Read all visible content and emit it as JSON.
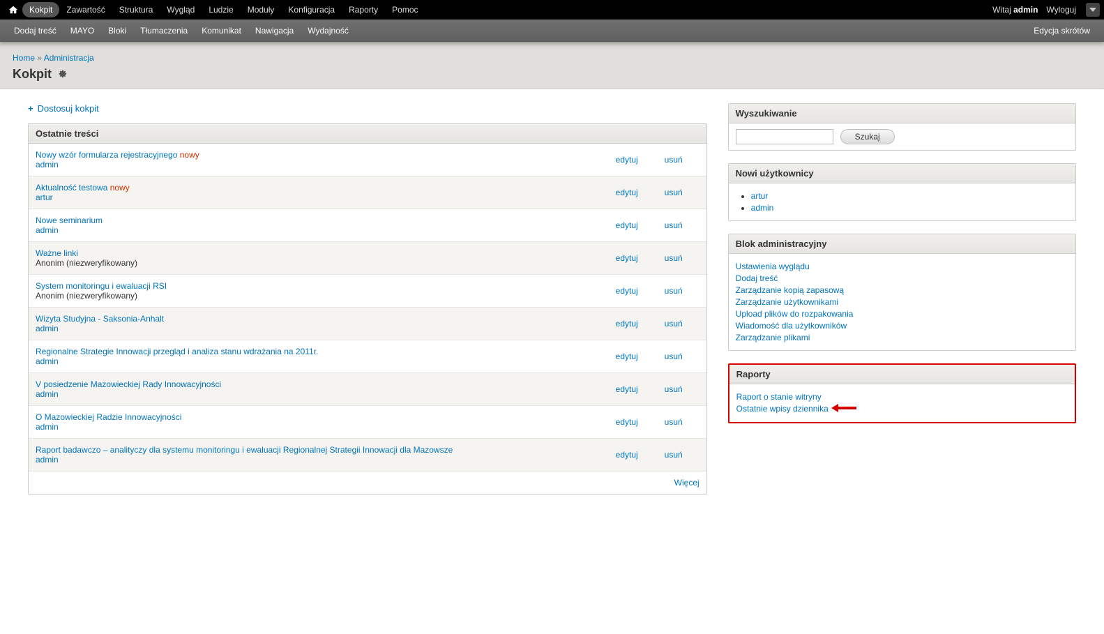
{
  "toolbar": {
    "items": [
      "Kokpit",
      "Zawartość",
      "Struktura",
      "Wygląd",
      "Ludzie",
      "Moduły",
      "Konfiguracja",
      "Raporty",
      "Pomoc"
    ],
    "welcome_prefix": "Witaj ",
    "welcome_user": "admin",
    "logout": "Wyloguj"
  },
  "shortcuts": {
    "items": [
      "Dodaj treść",
      "MAYO",
      "Bloki",
      "Tłumaczenia",
      "Komunikat",
      "Nawigacja",
      "Wydajność"
    ],
    "edit": "Edycja skrótów"
  },
  "breadcrumb": {
    "home": "Home",
    "sep": " » ",
    "admin": "Administracja"
  },
  "page_title": "Kokpit",
  "customize": "Dostosuj kokpit",
  "recent": {
    "title": "Ostatnie treści",
    "edit": "edytuj",
    "del": "usuń",
    "new": "nowy",
    "more": "Więcej",
    "rows": [
      {
        "t": "Nowy wzór formularza rejestracyjnego",
        "is_new": true,
        "author": "admin",
        "anon": false
      },
      {
        "t": "Aktualność testowa",
        "is_new": true,
        "author": "artur",
        "anon": false
      },
      {
        "t": "Nowe seminarium",
        "is_new": false,
        "author": "admin",
        "anon": false
      },
      {
        "t": "Ważne linki",
        "is_new": false,
        "author": "Anonim (niezweryfikowany)",
        "anon": true
      },
      {
        "t": "System monitoringu i ewaluacji RSI",
        "is_new": false,
        "author": "Anonim (niezweryfikowany)",
        "anon": true
      },
      {
        "t": "Wizyta Studyjna - Saksonia-Anhalt",
        "is_new": false,
        "author": "admin",
        "anon": false
      },
      {
        "t": "Regionalne Strategie Innowacji przegląd i analiza stanu wdrażania na 2011r.",
        "is_new": false,
        "author": "admin",
        "anon": false
      },
      {
        "t": "V posiedzenie Mazowieckiej Rady Innowacyjności",
        "is_new": false,
        "author": "admin",
        "anon": false
      },
      {
        "t": "O Mazowieckiej Radzie Innowacyjności",
        "is_new": false,
        "author": "admin",
        "anon": false
      },
      {
        "t": "Raport badawczo – analityczy dla systemu monitoringu i ewaluacji Regionalnej Strategii Innowacji dla Mazowsze",
        "is_new": false,
        "author": "admin",
        "anon": false
      }
    ]
  },
  "search": {
    "title": "Wyszukiwanie",
    "button": "Szukaj"
  },
  "new_users": {
    "title": "Nowi użytkownicy",
    "items": [
      "artur",
      "admin"
    ]
  },
  "admin_block": {
    "title": "Blok administracyjny",
    "items": [
      "Ustawienia wyglądu",
      "Dodaj treść",
      "Zarządzanie kopią zapasową",
      "Zarządzanie użytkownikami",
      "Upload plików do rozpakowania",
      "Wiadomość dla użytkowników",
      "Zarządzanie plikami"
    ]
  },
  "reports": {
    "title": "Raporty",
    "items": [
      "Raport o stanie witryny",
      "Ostatnie wpisy dziennika"
    ]
  }
}
